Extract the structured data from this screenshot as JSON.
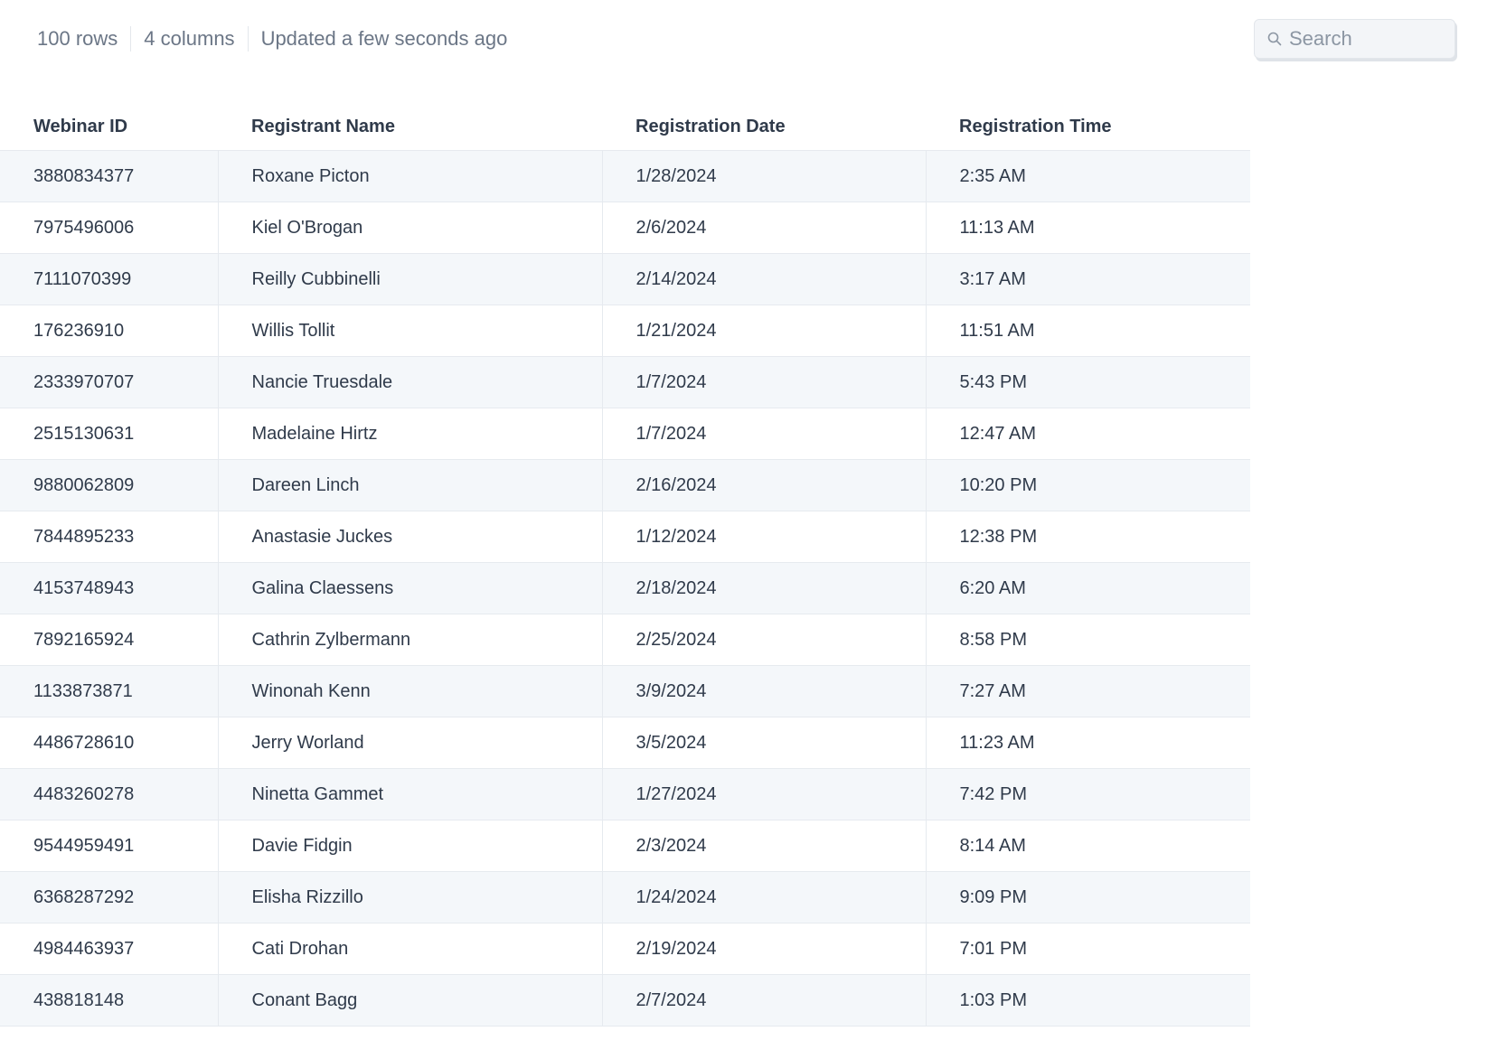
{
  "header": {
    "rows_label": "100 rows",
    "columns_label": "4 columns",
    "updated_label": "Updated a few seconds ago"
  },
  "search": {
    "placeholder": "Search",
    "icon": "search-icon"
  },
  "table": {
    "columns": [
      "Webinar ID",
      "Registrant Name",
      "Registration Date",
      "Registration Time"
    ],
    "rows": [
      [
        "3880834377",
        "Roxane Picton",
        "1/28/2024",
        "2:35 AM"
      ],
      [
        "7975496006",
        "Kiel O'Brogan",
        "2/6/2024",
        "11:13 AM"
      ],
      [
        "7111070399",
        "Reilly Cubbinelli",
        "2/14/2024",
        "3:17 AM"
      ],
      [
        "176236910",
        "Willis Tollit",
        "1/21/2024",
        "11:51 AM"
      ],
      [
        "2333970707",
        "Nancie Truesdale",
        "1/7/2024",
        "5:43 PM"
      ],
      [
        "2515130631",
        "Madelaine Hirtz",
        "1/7/2024",
        "12:47 AM"
      ],
      [
        "9880062809",
        "Dareen Linch",
        "2/16/2024",
        "10:20 PM"
      ],
      [
        "7844895233",
        "Anastasie Juckes",
        "1/12/2024",
        "12:38 PM"
      ],
      [
        "4153748943",
        "Galina Claessens",
        "2/18/2024",
        "6:20 AM"
      ],
      [
        "7892165924",
        "Cathrin Zylbermann",
        "2/25/2024",
        "8:58 PM"
      ],
      [
        "1133873871",
        "Winonah Kenn",
        "3/9/2024",
        "7:27 AM"
      ],
      [
        "4486728610",
        "Jerry Worland",
        "3/5/2024",
        "11:23 AM"
      ],
      [
        "4483260278",
        "Ninetta Gammet",
        "1/27/2024",
        "7:42 PM"
      ],
      [
        "9544959491",
        "Davie Fidgin",
        "2/3/2024",
        "8:14 AM"
      ],
      [
        "6368287292",
        "Elisha Rizzillo",
        "1/24/2024",
        "9:09 PM"
      ],
      [
        "4984463937",
        "Cati Drohan",
        "2/19/2024",
        "7:01 PM"
      ],
      [
        "438818148",
        "Conant Bagg",
        "2/7/2024",
        "1:03 PM"
      ]
    ]
  },
  "colors": {
    "row_stripe": "#f4f7fa",
    "border": "#e6eaef",
    "text": "#2f3a4a",
    "muted_text": "#6b7686"
  }
}
